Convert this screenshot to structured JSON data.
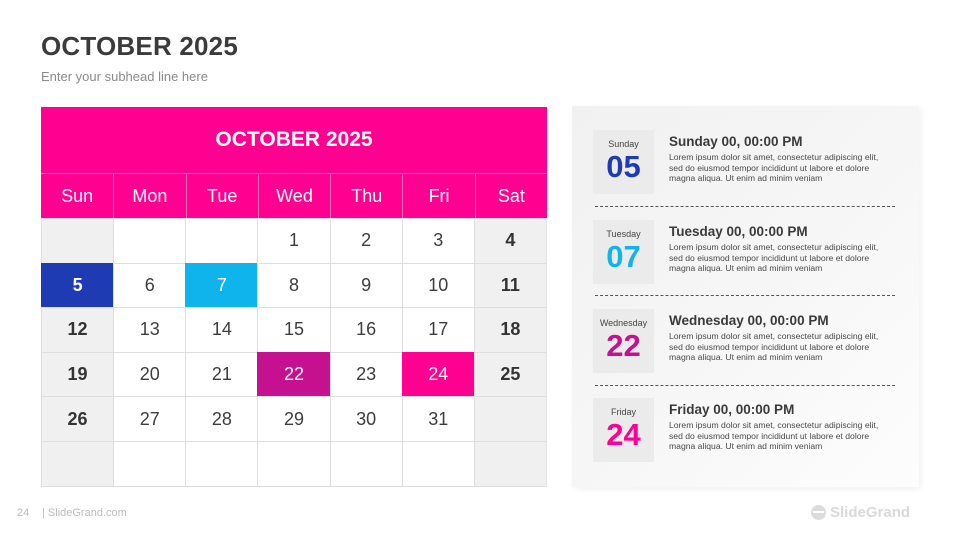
{
  "header": {
    "title": "OCTOBER 2025",
    "subtitle": "Enter your subhead line here"
  },
  "calendar": {
    "title": "OCTOBER 2025",
    "weekdays": [
      "Sun",
      "Mon",
      "Tue",
      "Wed",
      "Thu",
      "Fri",
      "Sat"
    ],
    "weeks": [
      [
        "",
        "",
        "",
        "1",
        "2",
        "3",
        "4"
      ],
      [
        "5",
        "6",
        "7",
        "8",
        "9",
        "10",
        "11"
      ],
      [
        "12",
        "13",
        "14",
        "15",
        "16",
        "17",
        "18"
      ],
      [
        "19",
        "20",
        "21",
        "22",
        "23",
        "24",
        "25"
      ],
      [
        "26",
        "27",
        "28",
        "29",
        "30",
        "31",
        ""
      ],
      [
        "",
        "",
        "",
        "",
        "",
        "",
        ""
      ]
    ],
    "highlights": {
      "5": "#1f3bb3",
      "7": "#0fb4ec",
      "22": "#c5118f",
      "24": "#ff0090"
    }
  },
  "colors": {
    "accent": "#ff0090",
    "blue": "#1f3bb3",
    "cyan": "#0fb4ec",
    "magenta": "#c5118f"
  },
  "events": [
    {
      "day_name": "Sunday",
      "day_num": "05",
      "color": "#1f3bb3",
      "title": "Sunday 00, 00:00 PM",
      "text": "Lorem ipsum dolor sit amet, consectetur adipiscing elit, sed do eiusmod tempor incididunt ut labore et dolore magna aliqua. Ut enim ad minim veniam"
    },
    {
      "day_name": "Tuesday",
      "day_num": "07",
      "color": "#0fb4ec",
      "title": "Tuesday 00, 00:00 PM",
      "text": "Lorem ipsum dolor sit amet, consectetur adipiscing elit, sed do eiusmod tempor incididunt ut labore et dolore magna aliqua. Ut enim ad minim veniam"
    },
    {
      "day_name": "Wednesday",
      "day_num": "22",
      "color": "#c5118f",
      "title": "Wednesday 00, 00:00 PM",
      "text": "Lorem ipsum dolor sit amet, consectetur adipiscing elit, sed do eiusmod tempor incididunt ut labore et dolore magna aliqua. Ut enim ad minim veniam"
    },
    {
      "day_name": "Friday",
      "day_num": "24",
      "color": "#ff0090",
      "title": "Friday 00, 00:00 PM",
      "text": "Lorem ipsum dolor sit amet, consectetur adipiscing elit, sed do eiusmod tempor incididunt ut labore et dolore magna aliqua. Ut enim ad minim veniam"
    }
  ],
  "footer": {
    "page_number": "24",
    "site": "| SlideGrand.com",
    "brand": "SlideGrand",
    "brand_icon": "slidegrand-logo-icon"
  }
}
